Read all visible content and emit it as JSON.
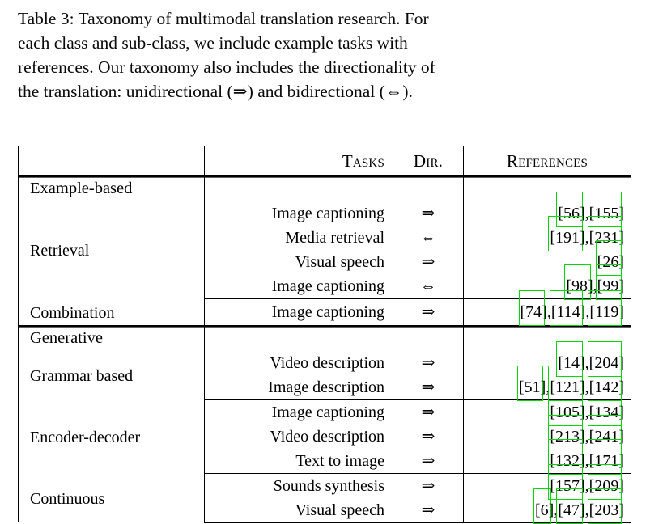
{
  "caption": {
    "lines": [
      "Table 3: Taxonomy of multimodal translation research. For",
      "each class and sub-class, we include example tasks with",
      "references. Our taxonomy also includes the directionality of",
      "the translation: unidirectional (⇒) and bidirectional (⇔)."
    ],
    "full": "Table 3: Taxonomy of multimodal translation research. For each class and sub-class, we include example tasks with references. Our taxonomy also includes the directionality of the translation: unidirectional (⇒) and bidirectional (⇔)."
  },
  "colors": {
    "highlight_box": "#00d800",
    "rule": "#000000",
    "text": "#000000",
    "background": "#ffffff"
  },
  "table": {
    "columns": [
      {
        "key": "class",
        "header": ""
      },
      {
        "key": "tasks",
        "header": "Tasks"
      },
      {
        "key": "dir",
        "header": "Dir."
      },
      {
        "key": "references",
        "header": "References"
      }
    ],
    "sections": [
      {
        "name": "Example-based",
        "groups": [
          {
            "class": "Retrieval",
            "rows": [
              {
                "task": "Image captioning",
                "dir": "⇒",
                "refs": [
                  "[56]",
                  "[155]"
                ]
              },
              {
                "task": "Media retrieval",
                "dir": "⇔",
                "refs": [
                  "[191]",
                  "[231]"
                ]
              },
              {
                "task": "Visual speech",
                "dir": "⇒",
                "refs": [
                  "[26]"
                ]
              },
              {
                "task": "Image captioning",
                "dir": "⇔",
                "refs": [
                  "[98]",
                  "[99]"
                ]
              }
            ]
          },
          {
            "class": "Combination",
            "rows": [
              {
                "task": "Image captioning",
                "dir": "⇒",
                "refs": [
                  "[74]",
                  "[114]",
                  "[119]"
                ]
              }
            ]
          }
        ]
      },
      {
        "name": "Generative",
        "groups": [
          {
            "class": "Grammar based",
            "rows": [
              {
                "task": "Video description",
                "dir": "⇒",
                "refs": [
                  "[14]",
                  "[204]"
                ]
              },
              {
                "task": "Image description",
                "dir": "⇒",
                "refs": [
                  "[51]",
                  "[121]",
                  "[142]"
                ]
              }
            ]
          },
          {
            "class": "Encoder-decoder",
            "rows": [
              {
                "task": "Image captioning",
                "dir": "⇒",
                "refs": [
                  "[105]",
                  "[134]"
                ]
              },
              {
                "task": "Video description",
                "dir": "⇒",
                "refs": [
                  "[213]",
                  "[241]"
                ]
              },
              {
                "task": "Text to image",
                "dir": "⇒",
                "refs": [
                  "[132]",
                  "[171]"
                ]
              }
            ]
          },
          {
            "class": "Continuous",
            "rows": [
              {
                "task": "Sounds synthesis",
                "dir": "⇒",
                "refs": [
                  "[157]",
                  "[209]"
                ]
              },
              {
                "task": "Visual speech",
                "dir": "⇒",
                "refs": [
                  "[6]",
                  "[47]",
                  "[203]"
                ]
              }
            ]
          }
        ]
      }
    ]
  }
}
